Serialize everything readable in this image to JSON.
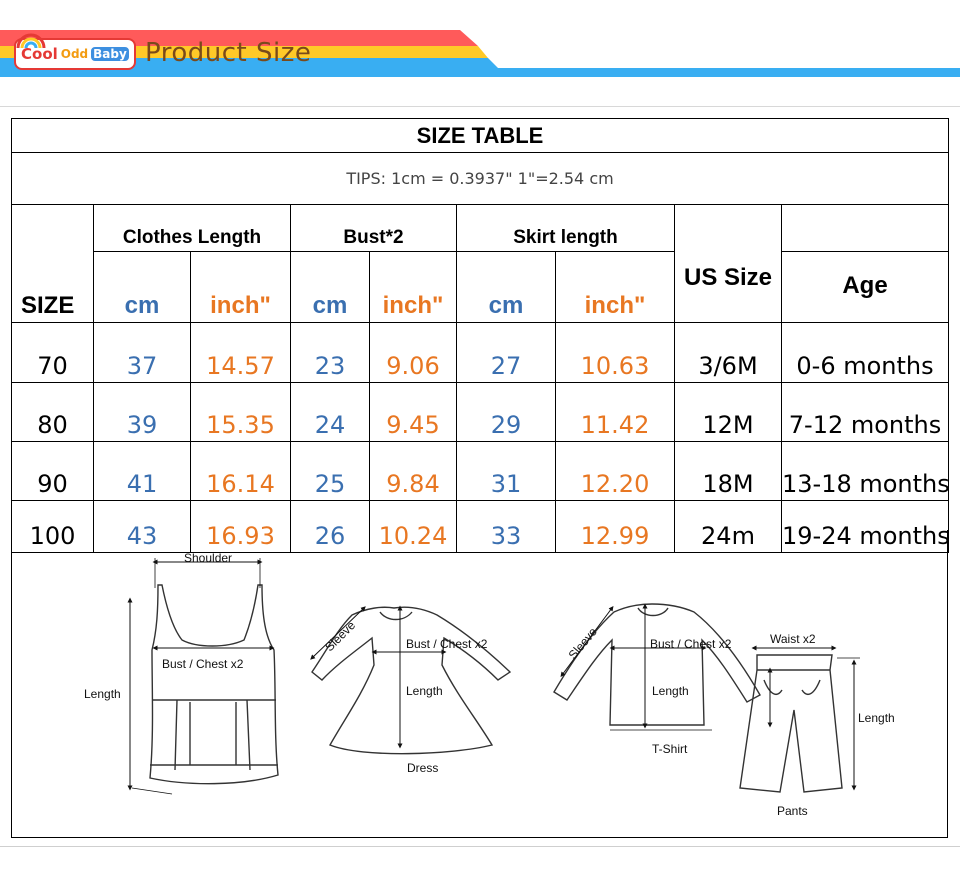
{
  "header": {
    "brand": {
      "word1": "Cool",
      "word2": "Odd",
      "word3": "Baby"
    },
    "title": "Product Size",
    "colors": {
      "red": "#ff5a5a",
      "yellow": "#ffc928",
      "blue": "#39aef2"
    }
  },
  "table": {
    "title": "SIZE TABLE",
    "tips": "TIPS: 1cm = 0.3937\"   1\"=2.54 cm",
    "groups": {
      "clothes_length": "Clothes Length",
      "bust": "Bust*2",
      "skirt_length": "Skirt length"
    },
    "headers": {
      "size": "SIZE",
      "cm": "cm",
      "inch": "inch\"",
      "us_size": "US Size",
      "age": "Age"
    },
    "rows": [
      {
        "size": "70",
        "cl_cm": "37",
        "cl_in": "14.57",
        "b_cm": "23",
        "b_in": "9.06",
        "s_cm": "27",
        "s_in": "10.63",
        "us": "3/6M",
        "age": "0-6 months"
      },
      {
        "size": "80",
        "cl_cm": "39",
        "cl_in": "15.35",
        "b_cm": "24",
        "b_in": "9.45",
        "s_cm": "29",
        "s_in": "11.42",
        "us": "12M",
        "age": "7-12 months"
      },
      {
        "size": "90",
        "cl_cm": "41",
        "cl_in": "16.14",
        "b_cm": "25",
        "b_in": "9.84",
        "s_cm": "31",
        "s_in": "12.20",
        "us": "18M",
        "age": "13-18 months"
      },
      {
        "size": "100",
        "cl_cm": "43",
        "cl_in": "16.93",
        "b_cm": "26",
        "b_in": "10.24",
        "s_cm": "33",
        "s_in": "12.99",
        "us": "24m",
        "age": "19-24 months"
      }
    ],
    "colors": {
      "cm": "#3a6fb0",
      "inch": "#e87722"
    }
  },
  "diagram": {
    "tank": {
      "shoulder": "Shoulder",
      "bust": "Bust / Chest x2",
      "length": "Length"
    },
    "dress": {
      "sleeve": "Sleeve",
      "bust": "Bust / Chest x2",
      "length": "Length",
      "caption": "Dress"
    },
    "tshirt": {
      "sleeve": "Sleeve",
      "bust": "Bust / Chest x2",
      "length": "Length",
      "caption": "T-Shirt"
    },
    "pants": {
      "waist": "Waist x2",
      "length": "Length",
      "caption": "Pants"
    }
  }
}
